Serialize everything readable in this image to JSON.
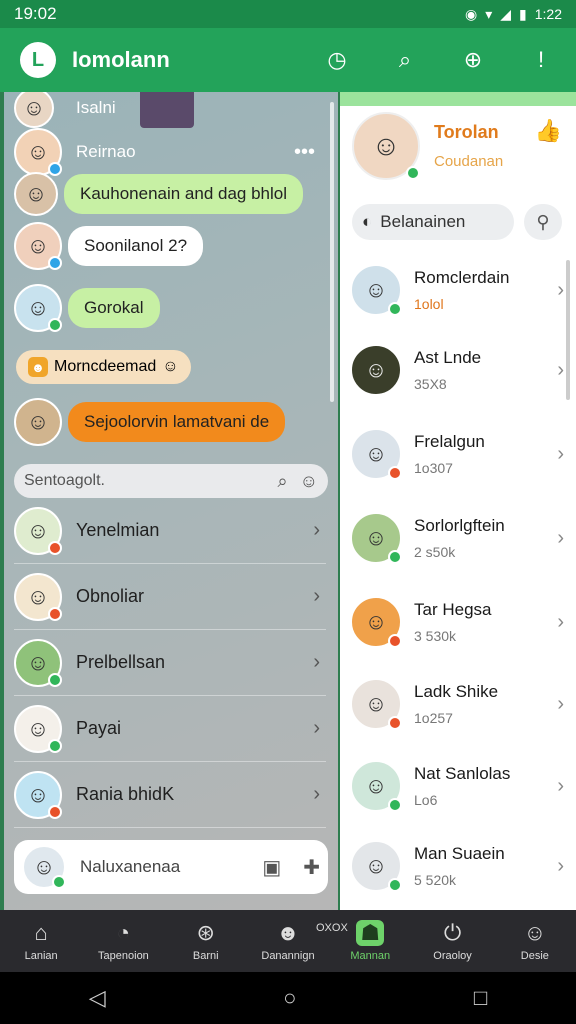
{
  "status": {
    "time": "19:02",
    "right_time": "1:22"
  },
  "app_bar": {
    "logo": "L",
    "title": "Iomolann"
  },
  "left": {
    "top_partial": "Isalni",
    "header_name": "Reirnao",
    "chats": [
      {
        "text": "Kauhonenain and dag bhlol"
      },
      {
        "text": "Soonilanol 2?"
      },
      {
        "text": "Gorokal"
      },
      {
        "text": "Sejoolorvin lamatvani de"
      }
    ],
    "pill_label": "Morncdeemad",
    "search_placeholder": "Sentoagolt.",
    "list": [
      {
        "name": "Yenelmian"
      },
      {
        "name": "Obnoliar"
      },
      {
        "name": "Prelbellsan"
      },
      {
        "name": "Payai"
      },
      {
        "name": "Rania bhidK"
      }
    ],
    "input_placeholder": "Naluxanenaa"
  },
  "right": {
    "profile_name": "Torolan",
    "profile_sub": "Coudanan",
    "search_placeholder": "Belanainen",
    "contacts": [
      {
        "name": "Romclerdain",
        "sub": "1olol"
      },
      {
        "name": "Ast Lnde",
        "sub": "35X8"
      },
      {
        "name": "Frelalgun",
        "sub": "1o307"
      },
      {
        "name": "Sorlorlgftein",
        "sub": "2 s50k"
      },
      {
        "name": "Tar Hegsa",
        "sub": "3 530k"
      },
      {
        "name": "Ladk Shike",
        "sub": "1o257"
      },
      {
        "name": "Nat Sanlolas",
        "sub": "Lo6"
      },
      {
        "name": "Man Suaein",
        "sub": "5 520k"
      }
    ]
  },
  "nav": {
    "items": [
      {
        "label": "Lanian"
      },
      {
        "label": "Tapenoion"
      },
      {
        "label": "Barni"
      },
      {
        "label": "Danannign"
      },
      {
        "label": "Mannan"
      },
      {
        "label": "Oraoloy"
      },
      {
        "label": "Desie"
      }
    ],
    "extra": "OXOX"
  },
  "colors": {
    "primary": "#23a35a",
    "accent_orange": "#f28a1c",
    "bubble_green": "#c7f0a4"
  },
  "icons": [
    "check-circle-icon",
    "search-icon",
    "search-alert-icon",
    "more-icon",
    "home-icon",
    "clock-icon",
    "gamepad-icon",
    "profile-icon",
    "power-icon",
    "user-icon",
    "back-icon",
    "home-circle-icon",
    "recent-square-icon"
  ]
}
